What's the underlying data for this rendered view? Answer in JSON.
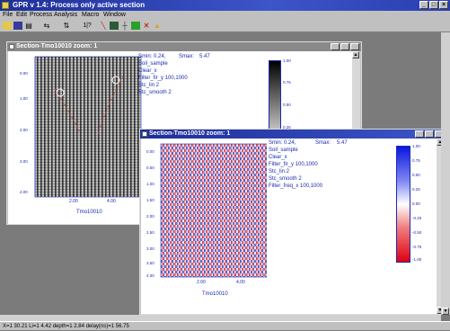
{
  "app": {
    "title": "GPR v 1.4: Process only active section",
    "window_buttons": [
      "_",
      "□",
      "×"
    ]
  },
  "menu": [
    "File",
    "Edit",
    "Process",
    "Analysis",
    "Macro",
    "Window"
  ],
  "toolbar": [
    "open-icon",
    "save-icon",
    "print-icon",
    "shift-left-right-icon",
    "shift-up-down-icon",
    "numbers-icon",
    "diagonal-icon",
    "filter-icon",
    "grid-icon",
    "color-icon",
    "warning-icon"
  ],
  "windows": [
    {
      "title": "Section-Tmo10010     zoom: 1",
      "state": "inactive",
      "smin_label": "Smin:",
      "smin": "0.24,",
      "smax_label": "Smax:",
      "smax": "5.47",
      "processing": [
        "Soil_sample",
        "Clear_x",
        "Filter_fir_y 100,1000",
        "Stc_lin 2",
        "Stc_smooth 2"
      ],
      "y_ticks": [
        "0.00",
        "1.00",
        "2.00",
        "3.00",
        "4.00"
      ],
      "x_ticks": [
        "2.00",
        "4.00"
      ],
      "x_label": "Tmo10010",
      "colorbar_ticks": [
        "1.00",
        "0.75",
        "0.50",
        "0.25",
        "0.00"
      ]
    },
    {
      "title": "Section-Tmo10010    zoom: 1",
      "state": "active",
      "smin_label": "Smin:",
      "smin": "0.24,",
      "smax_label": "Smax:",
      "smax": "5.47",
      "processing": [
        "Soil_sample",
        "Clear_x",
        "Filter_fir_y 100,1000",
        "Stc_lin 2",
        "Stc_smooth 2",
        "Filter_freq_x 100,1000"
      ],
      "y_ticks": [
        "0.00",
        "0.50",
        "1.00",
        "1.50",
        "2.00",
        "2.50",
        "3.00",
        "3.50",
        "4.00"
      ],
      "x_ticks": [
        "2.00",
        "4.00"
      ],
      "x_label": "Tmo10010",
      "colorbar_ticks": [
        "1.00",
        "0.75",
        "0.50",
        "0.25",
        "0.00",
        "-0.25",
        "-0.50",
        "-0.75",
        "-1.00"
      ]
    }
  ],
  "status": "X=1 30.21   Li=1 4.42   depth=1 2.84   delay(ns)=1 56.75"
}
